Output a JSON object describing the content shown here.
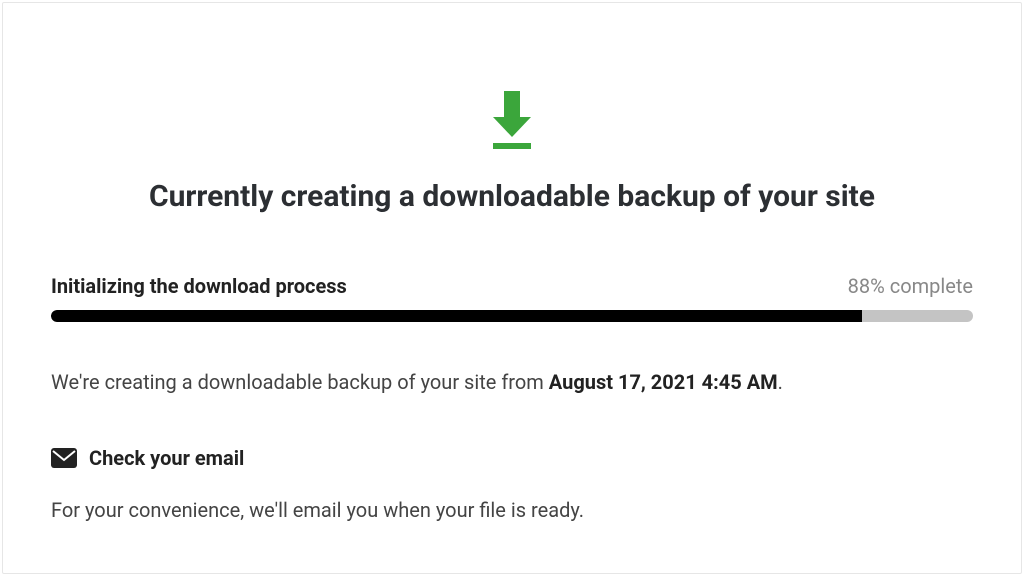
{
  "header": {
    "title": "Currently creating a downloadable backup of your site"
  },
  "progress": {
    "label": "Initializing the download process",
    "percent": 88,
    "complete_text": "88% complete"
  },
  "body": {
    "prefix": "We're creating a downloadable backup of your site from ",
    "timestamp": "August 17, 2021 4:45 AM",
    "suffix": "."
  },
  "email": {
    "heading": "Check your email",
    "note": "For your convenience, we'll email you when your file is ready."
  },
  "colors": {
    "accent": "#3ba63b"
  }
}
